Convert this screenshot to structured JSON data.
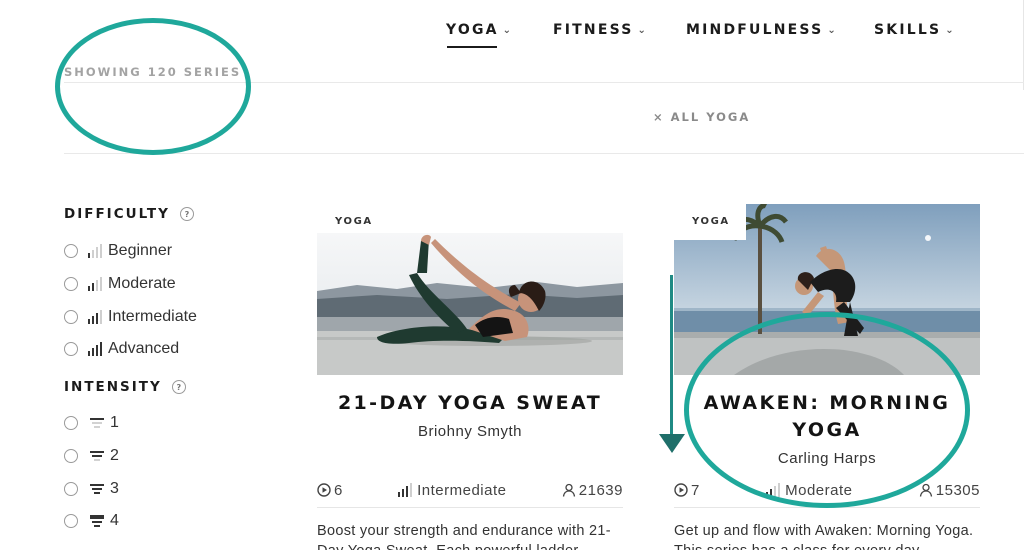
{
  "nav": {
    "items": [
      {
        "label": "YOGA",
        "active": true
      },
      {
        "label": "FITNESS",
        "active": false
      },
      {
        "label": "MINDFULNESS",
        "active": false
      },
      {
        "label": "SKILLS",
        "active": false
      }
    ],
    "chevron": "⌄"
  },
  "results": {
    "showing_text": "SHOWING 120 SERIES",
    "active_filter": "× ALL YOGA"
  },
  "filters": {
    "difficulty": {
      "heading": "DIFFICULTY",
      "help": "?",
      "options": [
        {
          "label": "Beginner",
          "level": 1
        },
        {
          "label": "Moderate",
          "level": 2
        },
        {
          "label": "Intermediate",
          "level": 3
        },
        {
          "label": "Advanced",
          "level": 4
        }
      ]
    },
    "intensity": {
      "heading": "INTENSITY",
      "help": "?",
      "options": [
        {
          "label": "1",
          "level": 1
        },
        {
          "label": "2",
          "level": 2
        },
        {
          "label": "3",
          "level": 3
        },
        {
          "label": "4",
          "level": 4
        }
      ]
    }
  },
  "cards": [
    {
      "tag": "YOGA",
      "title": "21-DAY YOGA SWEAT",
      "author": "Briohny Smyth",
      "episodes": "6",
      "difficulty": "Intermediate",
      "difficulty_level": 3,
      "members": "21639",
      "description": "Boost your strength and endurance with 21-Day Yoga Sweat. Each powerful ladder"
    },
    {
      "tag": "YOGA",
      "title": "AWAKEN: MORNING YOGA",
      "author": "Carling Harps",
      "episodes": "7",
      "difficulty": "Moderate",
      "difficulty_level": 2,
      "members": "15305",
      "description": "Get up and flow with Awaken: Morning Yoga. This series has a class for every day"
    }
  ],
  "colors": {
    "annotation": "#1fa89b",
    "text": "#1b1b1b",
    "muted": "#a3a3a3"
  }
}
